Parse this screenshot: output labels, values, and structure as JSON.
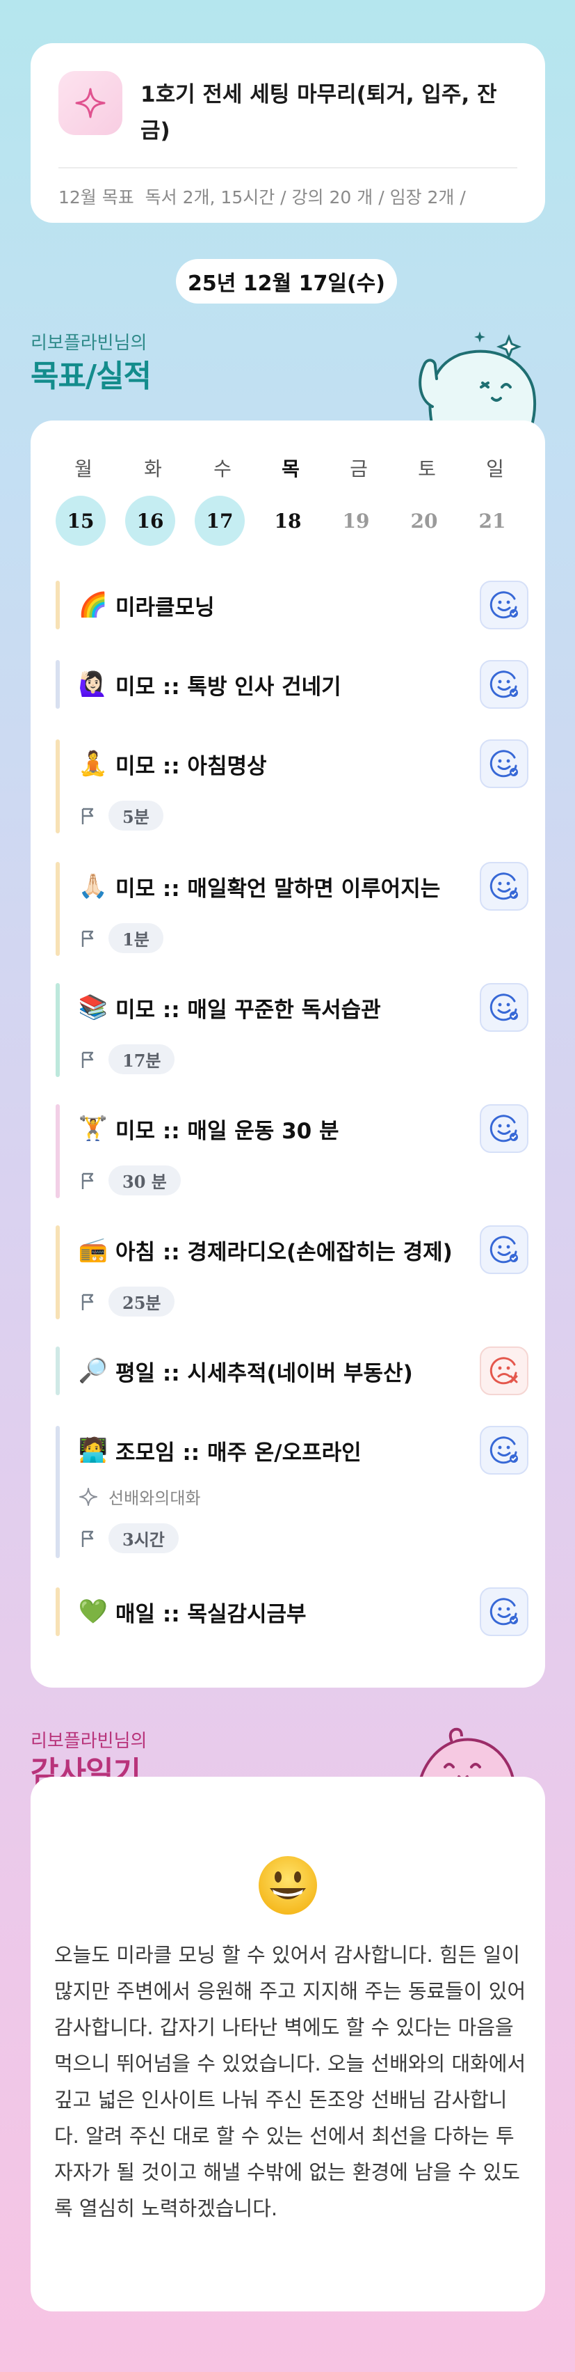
{
  "goal": {
    "title": "1호기 전세 세팅 마무리(퇴거, 입주, 잔금)",
    "month_label": "12월 목표",
    "summary": "독서 2개, 15시간 / 강의 20 개 / 임장 2개 /"
  },
  "date": "25년 12월 17일(수)",
  "goals_section": {
    "owner": "리보플라빈님의",
    "title": "목표/실적"
  },
  "week": [
    {
      "day": "월",
      "num": "15",
      "state": "done"
    },
    {
      "day": "화",
      "num": "16",
      "state": "done"
    },
    {
      "day": "수",
      "num": "17",
      "state": "done"
    },
    {
      "day": "목",
      "num": "18",
      "state": "today"
    },
    {
      "day": "금",
      "num": "19",
      "state": "future"
    },
    {
      "day": "토",
      "num": "20",
      "state": "future"
    },
    {
      "day": "일",
      "num": "21",
      "state": "future"
    }
  ],
  "items": [
    {
      "emoji": "🌈",
      "title": "미라클모닝",
      "bar": "#f7e1b5",
      "status": "done"
    },
    {
      "emoji": "🙋🏻‍♀️",
      "title": "미모 :: 톡방 인사 건네기",
      "bar": "#d8e0f0",
      "status": "done"
    },
    {
      "emoji": "🧘",
      "title": "미모 :: 아침명상",
      "bar": "#f7e1b5",
      "status": "done",
      "duration": "5분"
    },
    {
      "emoji": "🙏🏻",
      "title": "미모 :: 매일확언 말하면 이루어지는",
      "bar": "#f7e1b5",
      "status": "done",
      "duration": "1분"
    },
    {
      "emoji": "📚",
      "title": "미모 :: 매일 꾸준한 독서습관",
      "bar": "#bde8dc",
      "status": "done",
      "duration": "17분"
    },
    {
      "emoji": "🏋️",
      "title": "미모 :: 매일 운동 30 분",
      "bar": "#f2cfe6",
      "status": "done",
      "duration": "30 분"
    },
    {
      "emoji": "📻",
      "title": "아침 :: 경제라디오(손에잡히는 경제)",
      "bar": "#f7e1b5",
      "status": "done",
      "duration": "25분"
    },
    {
      "emoji": "🔎",
      "title": "평일 :: 시세추적(네이버 부동산)",
      "bar": "#cfe9e6",
      "status": "fail"
    },
    {
      "emoji": "🧑‍💻",
      "title": "조모임 :: 매주 온/오프라인",
      "bar": "#d8e0f0",
      "status": "done",
      "note": "선배와의대화",
      "duration": "3시간"
    },
    {
      "emoji": "💚",
      "title": "매일 :: 목실감시금부",
      "bar": "#f7e1b5",
      "status": "done"
    }
  ],
  "thanks_section": {
    "owner": "리보플라빈님의",
    "title": "감사일기"
  },
  "thanks_text": "오늘도 미라클 모닝 할 수 있어서 감사합니다. 힘든 일이 많지만 주변에서 응원해 주고 지지해 주는 동료들이 있어 감사합니다. 갑자기 나타난 벽에도 할 수 있다는 마음을 먹으니 뛰어넘을 수 있었습니다. 오늘 선배와의 대화에서 깊고 넓은 인사이트 나눠 주신 돈조앙 선배님 감사합니다. 알려 주신 대로 할 수 있는 선에서 최선을 다하는 투자자가 될 것이고 해낼 수밖에 없는 환경에 남을 수 있도록 열심히 노력하겠습니다."
}
